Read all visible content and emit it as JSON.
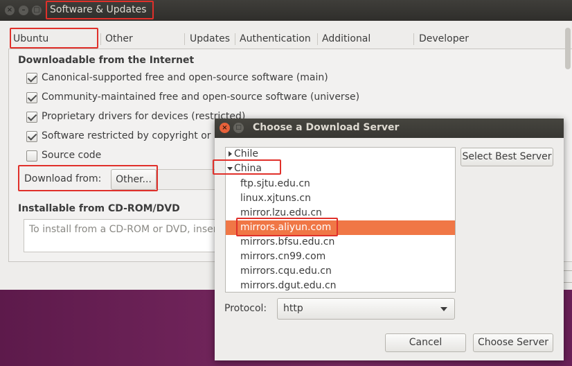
{
  "main_window": {
    "title": "Software & Updates",
    "tabs": [
      {
        "label": "Ubuntu Software"
      },
      {
        "label": "Other Software"
      },
      {
        "label": "Updates"
      },
      {
        "label": "Authentication"
      },
      {
        "label": "Additional Drivers"
      },
      {
        "label": "Developer Options"
      }
    ],
    "downloadable_title": "Downloadable from the Internet",
    "options": [
      {
        "label": "Canonical-supported free and open-source software (main)",
        "checked": true
      },
      {
        "label": "Community-maintained free and open-source software (universe)",
        "checked": true
      },
      {
        "label": "Proprietary drivers for devices (restricted)",
        "checked": true
      },
      {
        "label": "Software restricted by copyright or le",
        "checked": true
      },
      {
        "label": "Source code",
        "checked": false
      }
    ],
    "download_from_label": "Download from:",
    "download_from_value": "Other...",
    "cdrom_title": "Installable from CD-ROM/DVD",
    "cdrom_text": "To install from a CD-ROM or DVD, insert"
  },
  "dialog": {
    "title": "Choose a Download Server",
    "groups": [
      {
        "name": "Chile",
        "expanded": false
      },
      {
        "name": "China",
        "expanded": true
      }
    ],
    "servers": [
      "ftp.sjtu.edu.cn",
      "linux.xjtuns.cn",
      "mirror.lzu.edu.cn",
      "mirrors.aliyun.com",
      "mirrors.bfsu.edu.cn",
      "mirrors.cn99.com",
      "mirrors.cqu.edu.cn",
      "mirrors.dgut.edu.cn"
    ],
    "selected_server": "mirrors.aliyun.com",
    "select_best_label": "Select Best Server",
    "protocol_label": "Protocol:",
    "protocol_value": "http",
    "cancel_label": "Cancel",
    "choose_label": "Choose Server"
  },
  "colors": {
    "selection": "#f07746",
    "highlight_box": "#e0302a",
    "close_button": "#e8613a"
  }
}
